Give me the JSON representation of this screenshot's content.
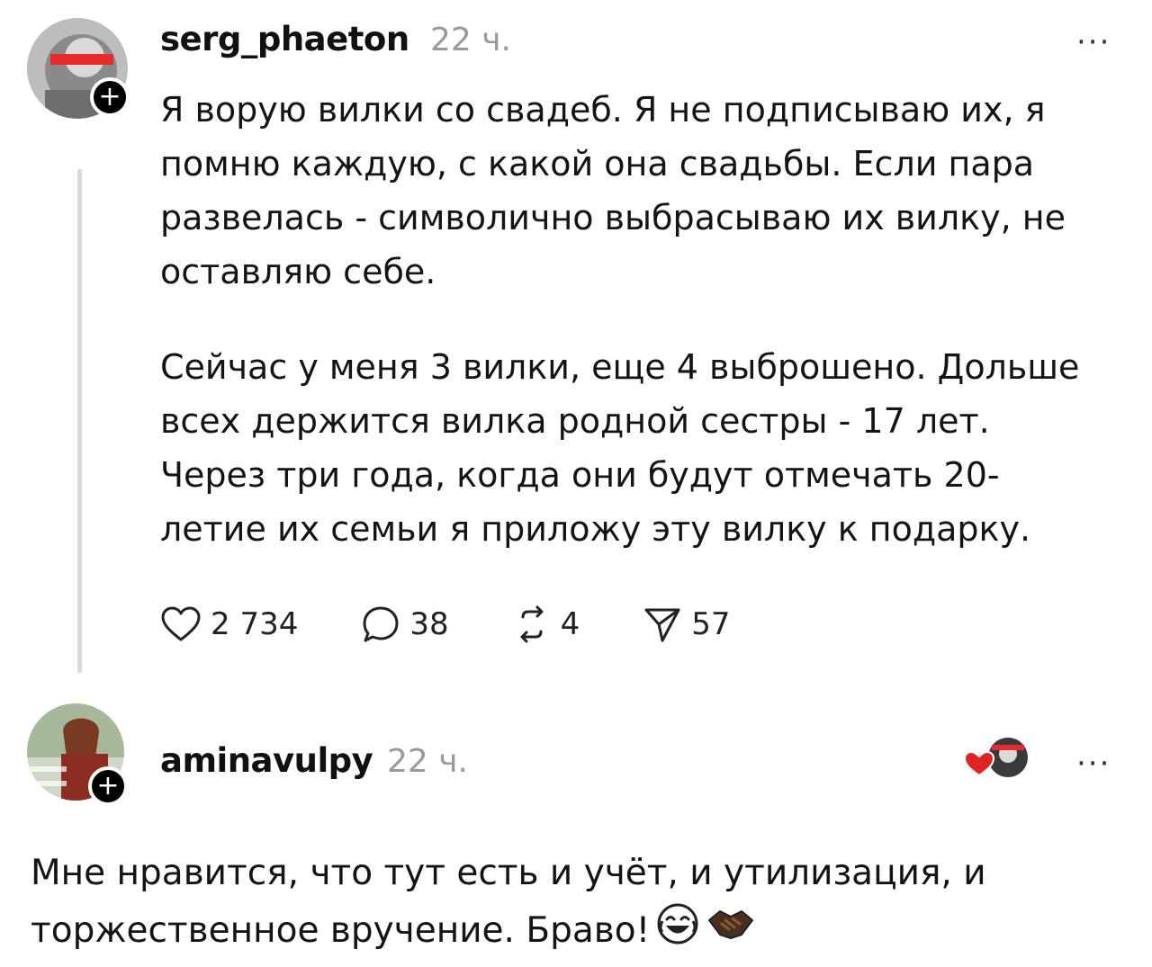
{
  "post": {
    "username": "serg_phaeton",
    "time": "22 ч.",
    "more_label": "···",
    "paragraph_1": "Я ворую вилки со свадеб. Я не подписываю их, я помню каждую, с какой она свадьбы. Если пара развелась - символично выбрасываю их вилку, не оставляю себе.",
    "paragraph_2": "Сейчас у меня 3 вилки, еще 4 выброшено. Дольше всех держится вилка родной сестры - 17 лет. Через три года, когда они будут отмечать 20-летие их семьи я приложу эту вилку к подарку.",
    "follow_label": "+",
    "actions": {
      "likes": "2 734",
      "comments": "38",
      "reposts": "4",
      "shares": "57"
    }
  },
  "reply": {
    "username": "aminavulpy",
    "time": "22 ч.",
    "more_label": "···",
    "follow_label": "+",
    "text": "Мне нравится, что тут есть и учёт, и утилизация, и торжественное вручение. Браво!"
  },
  "icons": {
    "like": "heart-icon",
    "comment": "comment-bubble-icon",
    "repost": "repost-icon",
    "share": "send-icon",
    "author_liked": "author-liked-heart-icon",
    "emoji_1": "laughing-tears-emoji",
    "emoji_2": "handshake-emoji"
  },
  "colors": {
    "accent_red": "#e02424",
    "muted": "#9a9a9a",
    "thread_line": "#d8d8d8"
  }
}
